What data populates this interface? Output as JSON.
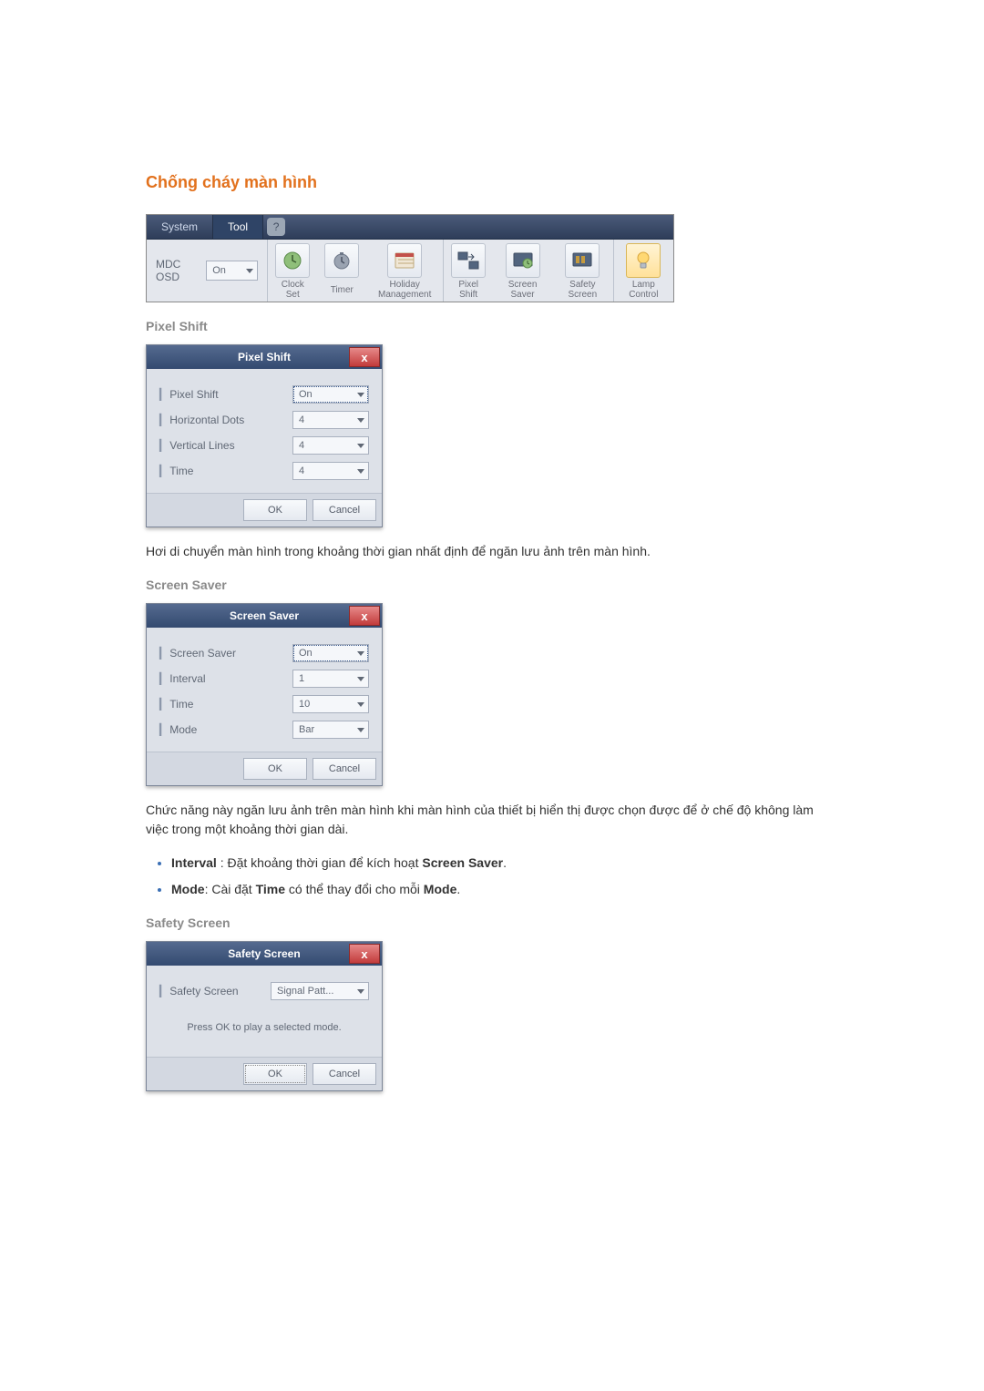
{
  "heading": "Chống cháy màn hình",
  "ribbon": {
    "tabs": {
      "system": "System",
      "tool": "Tool"
    },
    "help": "?",
    "mdc_osd_label": "MDC OSD",
    "mdc_osd_value": "On",
    "items": {
      "clock_set": "Clock Set",
      "timer": "Timer",
      "holiday_mgmt": "Holiday Management",
      "pixel_shift": "Pixel Shift",
      "screen_saver": "Screen Saver",
      "safety_screen": "Safety Screen",
      "lamp_control": "Lamp Control"
    }
  },
  "pixel_shift": {
    "subhead": "Pixel Shift",
    "dialog_title": "Pixel Shift",
    "rows": {
      "pixel_shift": {
        "label": "Pixel Shift",
        "value": "On"
      },
      "horizontal_dots": {
        "label": "Horizontal Dots",
        "value": "4"
      },
      "vertical_lines": {
        "label": "Vertical Lines",
        "value": "4"
      },
      "time": {
        "label": "Time",
        "value": "4"
      }
    },
    "desc": "Hơi di chuyển màn hình trong khoảng thời gian nhất định để ngăn lưu ảnh trên màn hình."
  },
  "screen_saver": {
    "subhead": "Screen Saver",
    "dialog_title": "Screen Saver",
    "rows": {
      "screen_saver": {
        "label": "Screen Saver",
        "value": "On"
      },
      "interval": {
        "label": "Interval",
        "value": "1"
      },
      "time": {
        "label": "Time",
        "value": "10"
      },
      "mode": {
        "label": "Mode",
        "value": "Bar"
      }
    },
    "desc": "Chức năng này ngăn lưu ảnh trên màn hình khi màn hình của thiết bị hiển thị được chọn được để ở chế độ không làm việc trong một khoảng thời gian dài.",
    "bullets": {
      "interval": {
        "key": "Interval",
        "text": " : Đặt khoảng thời gian để kích hoạt ",
        "key2": "Screen Saver",
        "tail": "."
      },
      "mode": {
        "key": "Mode",
        "text": ": Cài đặt ",
        "key2": "Time",
        "mid": " có thể thay đổi cho mỗi ",
        "key3": "Mode",
        "tail": "."
      }
    }
  },
  "safety_screen": {
    "subhead": "Safety Screen",
    "dialog_title": "Safety Screen",
    "rows": {
      "safety_screen": {
        "label": "Safety Screen",
        "value": "Signal Patt..."
      }
    },
    "note": "Press OK to play a selected mode."
  },
  "buttons": {
    "ok": "OK",
    "cancel": "Cancel",
    "close": "x"
  }
}
